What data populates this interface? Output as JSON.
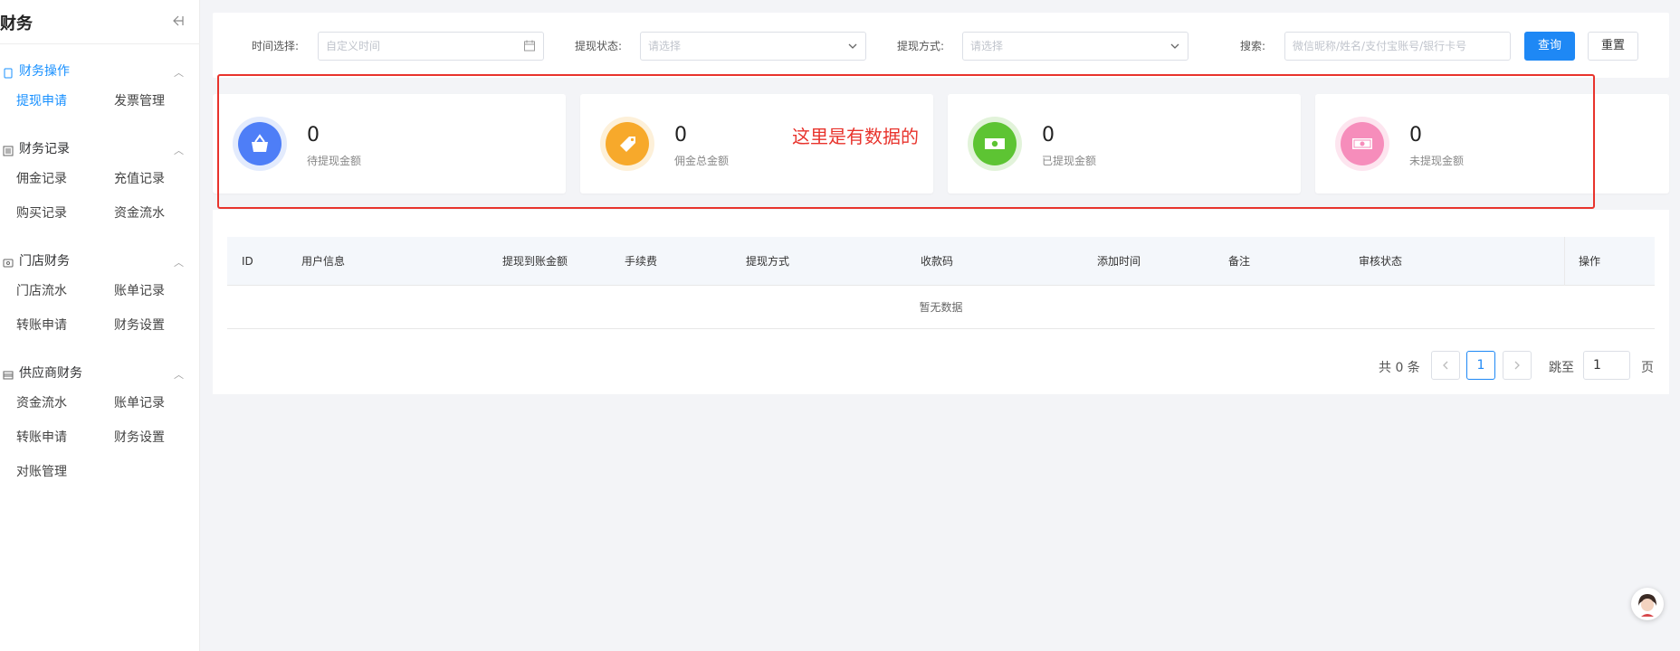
{
  "sidebar": {
    "title": "财务",
    "groups": [
      {
        "label": "财务操作",
        "items": [
          "提现申请",
          "发票管理"
        ]
      },
      {
        "label": "财务记录",
        "items": [
          "佣金记录",
          "充值记录",
          "购买记录",
          "资金流水"
        ]
      },
      {
        "label": "门店财务",
        "items": [
          "门店流水",
          "账单记录",
          "转账申请",
          "财务设置"
        ]
      },
      {
        "label": "供应商财务",
        "items": [
          "资金流水",
          "账单记录",
          "转账申请",
          "财务设置",
          "对账管理"
        ]
      }
    ]
  },
  "filters": {
    "time_label": "时间选择:",
    "time_placeholder": "自定义时间",
    "status_label": "提现状态:",
    "status_placeholder": "请选择",
    "method_label": "提现方式:",
    "method_placeholder": "请选择",
    "search_label": "搜索:",
    "search_placeholder": "微信昵称/姓名/支付宝账号/银行卡号",
    "query_button": "查询",
    "reset_button": "重置"
  },
  "stats": [
    {
      "value": "0",
      "label": "待提现金额",
      "color": "#4e7ef7",
      "ring": "#e3ebfd",
      "icon": "basket-icon"
    },
    {
      "value": "0",
      "label": "佣金总金额",
      "color": "#f7a92b",
      "ring": "#fdf0d9",
      "icon": "tag-icon"
    },
    {
      "value": "0",
      "label": "已提现金额",
      "color": "#5dc433",
      "ring": "#e2f3da",
      "icon": "cash-icon"
    },
    {
      "value": "0",
      "label": "未提现金额",
      "color": "#f68dbb",
      "ring": "#fde5ef",
      "icon": "money-note-icon"
    }
  ],
  "annotation": "这里是有数据的",
  "table": {
    "columns": [
      "ID",
      "用户信息",
      "提现到账金额",
      "手续费",
      "提现方式",
      "收款码",
      "添加时间",
      "备注",
      "审核状态",
      "操作"
    ],
    "empty_text": "暂无数据"
  },
  "pagination": {
    "total_text": "共 0 条",
    "current_page": "1",
    "jump_label": "跳至",
    "jump_value": "1",
    "page_suffix": "页"
  },
  "colors": {
    "accent": "#1e88f5",
    "annotation_red": "#e8332c"
  }
}
